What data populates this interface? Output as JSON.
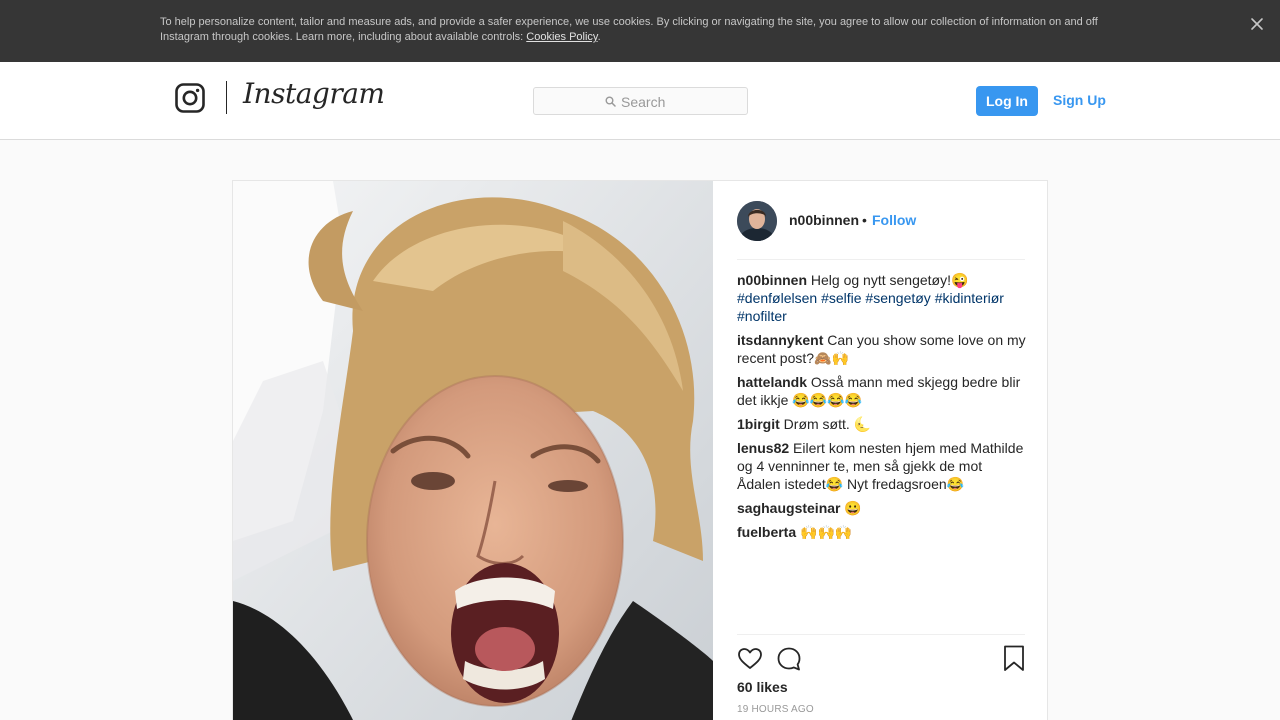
{
  "cookie_banner": {
    "text": "To help personalize content, tailor and measure ads, and provide a safer experience, we use cookies. By clicking or navigating the site, you agree to allow our collection of information on and off Instagram through cookies. Learn more, including about available controls: ",
    "link": "Cookies Policy",
    "trailing": ".",
    "close_icon": "close-icon"
  },
  "header": {
    "wordmark": "Instagram",
    "search_placeholder": "Search",
    "login": "Log In",
    "signup": "Sign Up"
  },
  "post": {
    "author": "n00binnen",
    "separator": "•",
    "follow": "Follow",
    "caption": {
      "user": "n00binnen",
      "text": " Helg og nytt sengetøy!😜 ",
      "hashtags": [
        "#denfølelsen",
        "#selfie",
        "#sengetøy",
        "#kidinteriør",
        "#nofilter"
      ]
    },
    "comments": [
      {
        "user": "itsdannykent",
        "text": " Can you show some love on my recent post?🙈🙌"
      },
      {
        "user": "hattelandk",
        "text": " Osså mann med skjegg bedre blir det ikkje 😂😂😂😂"
      },
      {
        "user": "1birgit",
        "text": " Drøm søtt. 🌜"
      },
      {
        "user": "lenus82",
        "text": " Eilert kom nesten hjem med Mathilde og 4 venninner te, men så gjekk de mot Ådalen istedet😂 Nyt fredagsroen😂"
      },
      {
        "user": "saghaugsteinar",
        "text": " 😀"
      },
      {
        "user": "fuelberta",
        "text": " 🙌🙌🙌"
      }
    ],
    "likes": "60 likes",
    "time": "19 HOURS AGO"
  },
  "colors": {
    "accent": "#3897f0",
    "hashtag": "#003569",
    "banner": "#363636"
  }
}
